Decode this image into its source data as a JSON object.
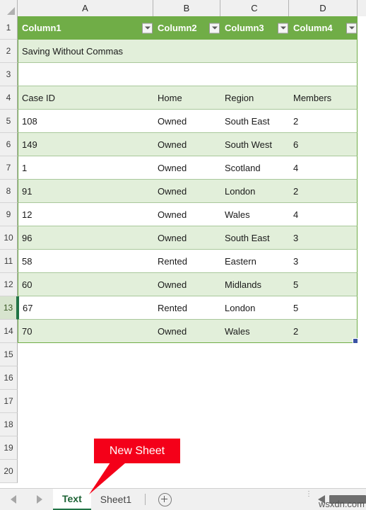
{
  "grid": {
    "column_headers": [
      "A",
      "B",
      "C",
      "D"
    ],
    "row_headers": [
      "1",
      "2",
      "3",
      "4",
      "5",
      "6",
      "7",
      "8",
      "9",
      "10",
      "11",
      "12",
      "13",
      "14",
      "15",
      "16",
      "17",
      "18",
      "19",
      "20"
    ],
    "selected_row": "13"
  },
  "table": {
    "header": {
      "col_a": "Column1",
      "col_b": "Column2",
      "col_c": "Column3",
      "col_d": "Column4",
      "filter_icon": "filter-dropdown-icon"
    },
    "title_row": "Saving Without Commas",
    "field_headers": [
      "Case ID",
      "Home",
      "Region",
      "Members"
    ],
    "rows": [
      {
        "case_id": "108",
        "home": "Owned",
        "region": "South East",
        "members": "2"
      },
      {
        "case_id": "149",
        "home": "Owned",
        "region": "South West",
        "members": "6"
      },
      {
        "case_id": "1",
        "home": "Owned",
        "region": "Scotland",
        "members": "4"
      },
      {
        "case_id": "91",
        "home": "Owned",
        "region": "London",
        "members": "2"
      },
      {
        "case_id": "12",
        "home": "Owned",
        "region": "Wales",
        "members": "4"
      },
      {
        "case_id": "96",
        "home": "Owned",
        "region": "South East",
        "members": "3"
      },
      {
        "case_id": "58",
        "home": "Rented",
        "region": "Eastern",
        "members": "3"
      },
      {
        "case_id": "60",
        "home": "Owned",
        "region": "Midlands",
        "members": "5"
      },
      {
        "case_id": "67",
        "home": "Rented",
        "region": "London",
        "members": "5"
      },
      {
        "case_id": "70",
        "home": "Owned",
        "region": "Wales",
        "members": "2"
      }
    ],
    "colors": {
      "header_green": "#70AD47",
      "band_light": "#E2EFDA",
      "band_white": "#FFFFFF",
      "border_green": "#70AD47"
    }
  },
  "annotation": {
    "label": "New Sheet",
    "color": "#F40019",
    "text_color": "#FFFFFF"
  },
  "tabbar": {
    "nav_prev_icon": "nav-previous-icon",
    "nav_next_icon": "nav-next-icon",
    "tabs": [
      {
        "label": "Text",
        "active": true
      },
      {
        "label": "Sheet1",
        "active": false
      }
    ],
    "add_sheet_icon": "add-sheet-plus-icon",
    "scroll_icon": "horizontal-scrollbar"
  },
  "watermark": "wsxdn.com"
}
